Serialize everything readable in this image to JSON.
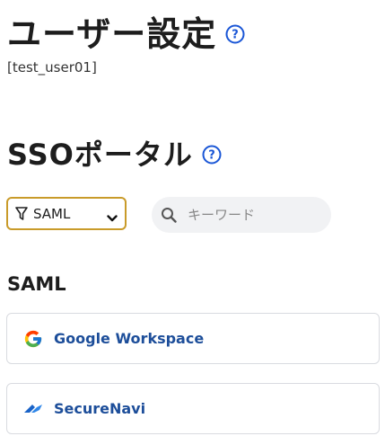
{
  "page": {
    "title": "ユーザー設定",
    "user_id": "[test_user01]"
  },
  "sso": {
    "title": "SSOポータル",
    "filter": {
      "selected": "SAML",
      "icon": "filter-icon"
    },
    "search": {
      "placeholder": "キーワード",
      "value": ""
    },
    "group_label": "SAML",
    "apps": [
      {
        "name": "Google Workspace",
        "icon": "google-logo"
      },
      {
        "name": "SecureNavi",
        "icon": "securenavi-logo"
      }
    ]
  },
  "colors": {
    "accent": "#c99b2a",
    "link": "#1d4e9a",
    "help": "#1a56d6"
  }
}
